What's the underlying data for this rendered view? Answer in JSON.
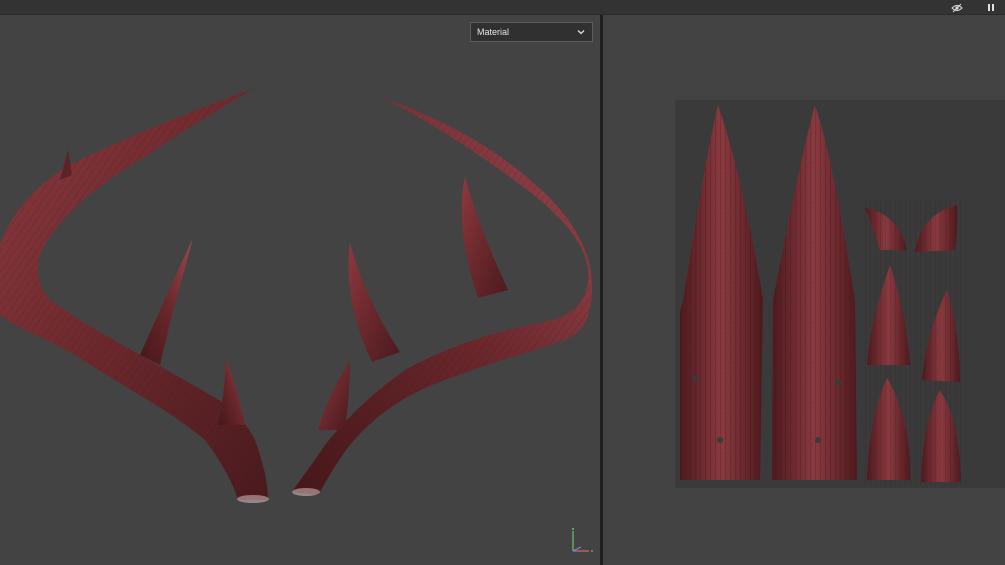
{
  "viewport3d": {
    "shading_mode": "Material",
    "model_icon": "antler-mesh",
    "axis_gizmo_icon": "xyz-axis-gizmo"
  },
  "viewport2d": {
    "content_icon": "uv-texture-sheet"
  },
  "toolbar": {
    "icons": [
      "hide-eye-icon",
      "pause-icon"
    ]
  },
  "colors": {
    "viewport_bg": "#434343",
    "uv_bg": "#3a3a3a",
    "antler_base": "#6e2a2e",
    "antler_highlight": "#a8585e",
    "antler_shadow": "#3e1518"
  }
}
